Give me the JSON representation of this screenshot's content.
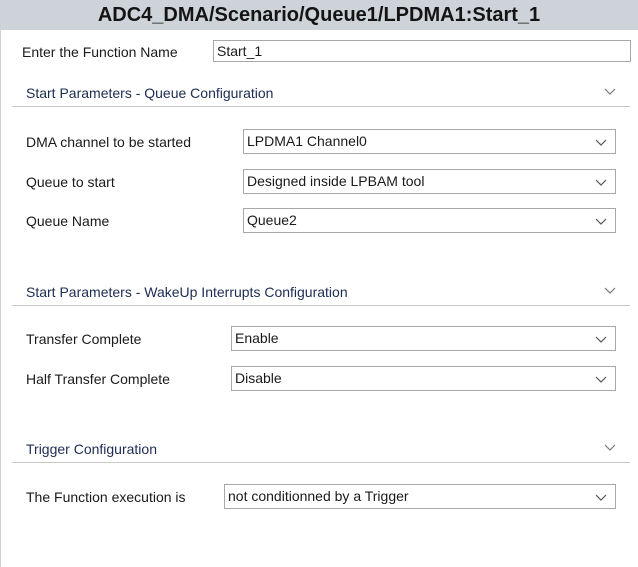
{
  "window": {
    "title": "ADC4_DMA/Scenario/Queue1/LPDMA1:Start_1"
  },
  "function_name": {
    "label": "Enter the Function Name",
    "value": "Start_1"
  },
  "queue_section": {
    "title": "Start Parameters - Queue Configuration",
    "fields": [
      {
        "label": "DMA channel to be started",
        "value": "LPDMA1 Channel0"
      },
      {
        "label": "Queue to start",
        "value": "Designed inside LPBAM tool"
      },
      {
        "label": "Queue Name",
        "value": "Queue2"
      }
    ]
  },
  "wakeup_section": {
    "title": "Start Parameters - WakeUp Interrupts Configuration",
    "fields": [
      {
        "label": "Transfer Complete",
        "value": "Enable"
      },
      {
        "label": "Half Transfer Complete",
        "value": "Disable"
      }
    ]
  },
  "trigger_section": {
    "title": "Trigger Configuration",
    "fields": [
      {
        "label": "The Function execution is",
        "value": "not conditionned by a Trigger"
      }
    ]
  },
  "icons": {
    "section_toggle": "chevron-down-icon",
    "dropdown": "chevron-down-icon"
  },
  "colors": {
    "title_bar_bg": "#cdd3d9",
    "section_title_text": "#1c2c52",
    "field_border": "#a8a8a8"
  }
}
